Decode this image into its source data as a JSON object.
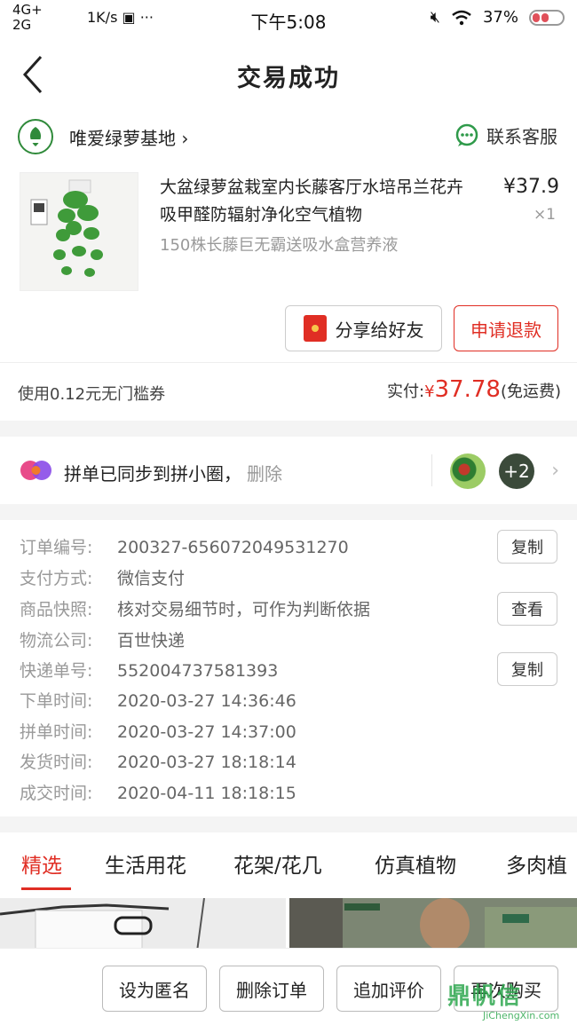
{
  "statusbar": {
    "network_top": "4G+",
    "network_bottom": "2G",
    "speed": "1K/s",
    "time": "下午5:08",
    "battery": "37%"
  },
  "navbar": {
    "title": "交易成功"
  },
  "shop": {
    "name": "唯爱绿萝基地",
    "contact_label": "联系客服"
  },
  "product": {
    "title": "大盆绿萝盆栽室内长藤客厅水培吊兰花卉吸甲醛防辐射净化空气植物",
    "spec": "150株长藤巨无霸送吸水盒营养液",
    "price": "¥37.9",
    "qty": "×1"
  },
  "actions": {
    "share_label": "分享给好友",
    "refund_label": "申请退款"
  },
  "payment": {
    "coupon_text": "使用0.12元无门槛券",
    "paid_label": "实付:",
    "currency": "¥",
    "paid_amount": "37.78",
    "shipping_note": "(免运费)"
  },
  "group": {
    "text": "拼单已同步到拼小圈，",
    "delete_label": "删除",
    "more_count": "+2"
  },
  "details": {
    "rows": [
      {
        "label": "订单编号:",
        "value": "200327-656072049531270",
        "button": "复制"
      },
      {
        "label": "支付方式:",
        "value": "微信支付"
      },
      {
        "label": "商品快照:",
        "value": "核对交易细节时，可作为判断依据",
        "button": "查看"
      },
      {
        "label": "物流公司:",
        "value": "百世快递"
      },
      {
        "label": "快递单号:",
        "value": "552004737581393",
        "button": "复制"
      },
      {
        "label": "下单时间:",
        "value": "2020-03-27 14:36:46"
      },
      {
        "label": "拼单时间:",
        "value": "2020-03-27 14:37:00"
      },
      {
        "label": "发货时间:",
        "value": "2020-03-27 18:18:14"
      },
      {
        "label": "成交时间:",
        "value": "2020-04-11 18:18:15"
      }
    ]
  },
  "tabs": [
    "精选",
    "生活用花",
    "花架/花几",
    "仿真植物",
    "多肉植"
  ],
  "bottom_actions": [
    "设为匿名",
    "删除订单",
    "追加评价",
    "再次购买"
  ],
  "watermark": {
    "main": "鼎帆信",
    "sub": "JiChengXin.com"
  },
  "colors": {
    "accent": "#e02e24",
    "green": "#2f8a3a"
  }
}
